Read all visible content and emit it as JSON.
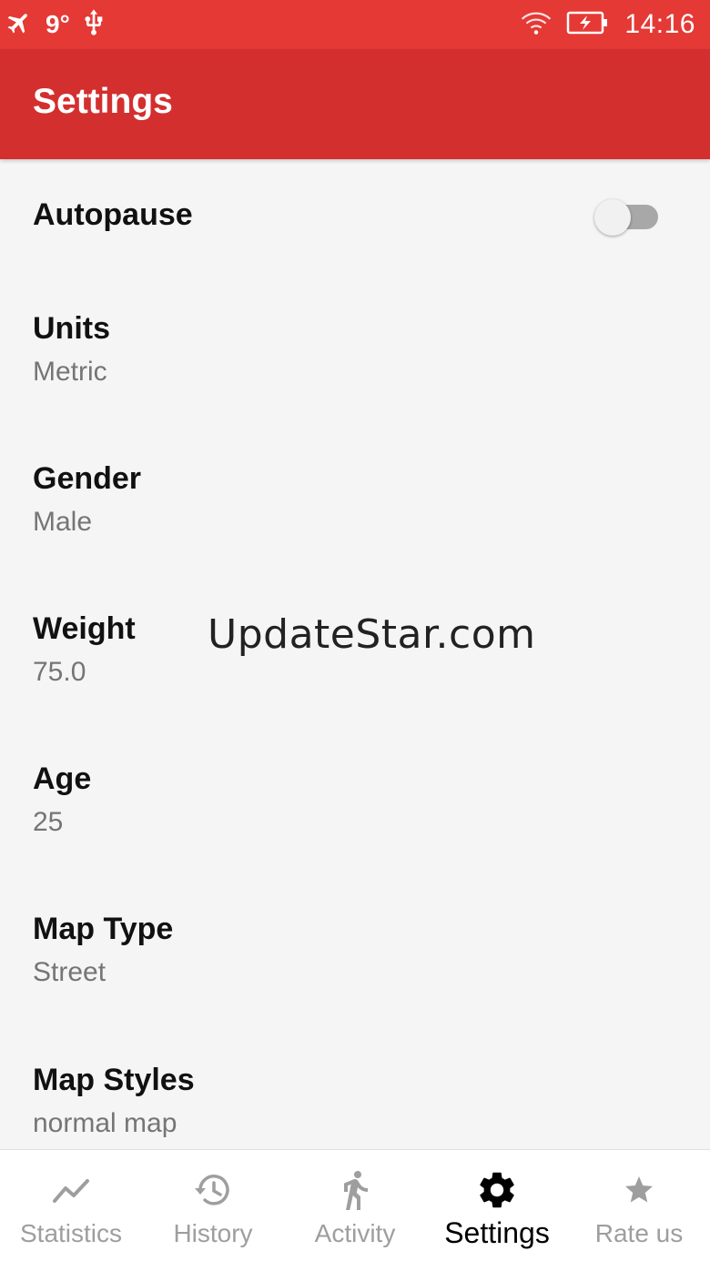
{
  "status_bar": {
    "temperature": "9°",
    "time": "14:16",
    "icons": [
      "airplane-icon",
      "usb-icon",
      "wifi-icon",
      "battery-charging-icon"
    ]
  },
  "app_bar": {
    "title": "Settings"
  },
  "settings": [
    {
      "label": "Autopause",
      "toggle_on": false
    },
    {
      "label": "Units",
      "value": "Metric"
    },
    {
      "label": "Gender",
      "value": "Male"
    },
    {
      "label": "Weight",
      "value": "75.0"
    },
    {
      "label": "Age",
      "value": "25"
    },
    {
      "label": "Map Type",
      "value": "Street"
    },
    {
      "label": "Map Styles",
      "value": "normal map"
    }
  ],
  "watermark": "UpdateStar.com",
  "bottom_nav": [
    {
      "label": "Statistics",
      "icon": "trending-chart-icon",
      "active": false
    },
    {
      "label": "History",
      "icon": "history-icon",
      "active": false
    },
    {
      "label": "Activity",
      "icon": "walking-icon",
      "active": false
    },
    {
      "label": "Settings",
      "icon": "gear-icon",
      "active": true
    },
    {
      "label": "Rate us",
      "icon": "star-icon",
      "active": false
    }
  ],
  "colors": {
    "status_bar": "#e53935",
    "app_bar": "#d32f2f",
    "background": "#f5f5f5",
    "label": "#111111",
    "value": "#757575",
    "nav_inactive": "#9e9e9e",
    "nav_active": "#000000"
  }
}
